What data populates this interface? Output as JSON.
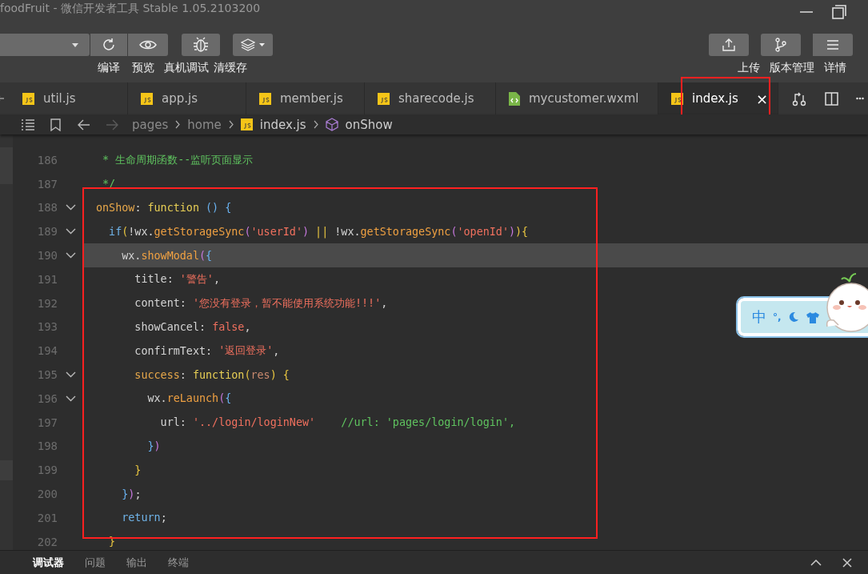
{
  "window": {
    "title": "foodFruit - 微信开发者工具 Stable 1.05.2103200"
  },
  "toolbar": {
    "left_labels": [
      "编译",
      "预览",
      "真机调试",
      "清缓存"
    ],
    "right_labels": [
      "上传",
      "版本管理",
      "详情"
    ]
  },
  "tabs": [
    {
      "label": "util.js",
      "kind": "js",
      "selected": false
    },
    {
      "label": "app.js",
      "kind": "js",
      "selected": false
    },
    {
      "label": "member.js",
      "kind": "js",
      "selected": false
    },
    {
      "label": "sharecode.js",
      "kind": "js",
      "selected": false
    },
    {
      "label": "mycustomer.wxml",
      "kind": "wxml",
      "selected": false
    },
    {
      "label": "index.js",
      "kind": "js",
      "selected": true,
      "close": "×"
    }
  ],
  "breadcrumb": [
    "pages",
    "home",
    "index.js",
    "onShow"
  ],
  "code": [
    {
      "number": "186",
      "fold": false,
      "current": false,
      "tokens": [
        {
          "kind": "cmt",
          "text": " * 生命周期函数--监听页面显示"
        }
      ]
    },
    {
      "number": "187",
      "fold": false,
      "current": false,
      "tokens": [
        {
          "kind": "cmt",
          "text": " */"
        }
      ]
    },
    {
      "number": "188",
      "fold": true,
      "current": false,
      "tokens": [
        {
          "kind": "key",
          "text": "onShow"
        },
        {
          "kind": "plain",
          "text": ": "
        },
        {
          "kind": "fn",
          "text": "function"
        },
        {
          "kind": "b3",
          "text": " () {"
        }
      ]
    },
    {
      "number": "189",
      "fold": true,
      "current": false,
      "tokens": [
        {
          "kind": "kw",
          "text": "  if"
        },
        {
          "kind": "b1",
          "text": "("
        },
        {
          "kind": "plain",
          "text": "!wx."
        },
        {
          "kind": "method",
          "text": "getStorageSync"
        },
        {
          "kind": "b2",
          "text": "("
        },
        {
          "kind": "str",
          "text": "'userId'"
        },
        {
          "kind": "b2",
          "text": ")"
        },
        {
          "kind": "b1",
          "text": " || "
        },
        {
          "kind": "plain",
          "text": "!wx."
        },
        {
          "kind": "method",
          "text": "getStorageSync"
        },
        {
          "kind": "b2",
          "text": "("
        },
        {
          "kind": "str",
          "text": "'openId'"
        },
        {
          "kind": "b2",
          "text": ")"
        },
        {
          "kind": "b1",
          "text": "){"
        }
      ]
    },
    {
      "number": "190",
      "fold": true,
      "current": true,
      "tokens": [
        {
          "kind": "plain",
          "text": "    wx."
        },
        {
          "kind": "method",
          "text": "showModal"
        },
        {
          "kind": "b2",
          "text": "("
        },
        {
          "kind": "b3",
          "text": "{"
        }
      ]
    },
    {
      "number": "191",
      "fold": false,
      "current": false,
      "tokens": [
        {
          "kind": "plain",
          "text": "      title: "
        },
        {
          "kind": "str",
          "text": "'警告'"
        },
        {
          "kind": "plain",
          "text": ","
        }
      ]
    },
    {
      "number": "192",
      "fold": false,
      "current": false,
      "tokens": [
        {
          "kind": "plain",
          "text": "      content: "
        },
        {
          "kind": "str",
          "text": "'您没有登录，暂不能使用系统功能!!!'"
        },
        {
          "kind": "plain",
          "text": ","
        }
      ]
    },
    {
      "number": "193",
      "fold": false,
      "current": false,
      "tokens": [
        {
          "kind": "plain",
          "text": "      showCancel: "
        },
        {
          "kind": "str",
          "text": "false"
        },
        {
          "kind": "plain",
          "text": ","
        }
      ]
    },
    {
      "number": "194",
      "fold": false,
      "current": false,
      "tokens": [
        {
          "kind": "plain",
          "text": "      confirmText: "
        },
        {
          "kind": "str",
          "text": "'返回登录'"
        },
        {
          "kind": "plain",
          "text": ","
        }
      ]
    },
    {
      "number": "195",
      "fold": true,
      "current": false,
      "tokens": [
        {
          "kind": "key",
          "text": "      success"
        },
        {
          "kind": "plain",
          "text": ": "
        },
        {
          "kind": "fn",
          "text": "function"
        },
        {
          "kind": "b1",
          "text": "("
        },
        {
          "kind": "param",
          "text": "res"
        },
        {
          "kind": "b1",
          "text": ") {"
        }
      ]
    },
    {
      "number": "196",
      "fold": true,
      "current": false,
      "tokens": [
        {
          "kind": "plain",
          "text": "        wx."
        },
        {
          "kind": "method",
          "text": "reLaunch"
        },
        {
          "kind": "b2",
          "text": "("
        },
        {
          "kind": "b3",
          "text": "{"
        }
      ]
    },
    {
      "number": "197",
      "fold": false,
      "current": false,
      "tokens": [
        {
          "kind": "plain",
          "text": "          url: "
        },
        {
          "kind": "str",
          "text": "'../login/loginNew'"
        },
        {
          "kind": "cmt",
          "text": "    //url: 'pages/login/login',"
        }
      ]
    },
    {
      "number": "198",
      "fold": false,
      "current": false,
      "tokens": [
        {
          "kind": "b3",
          "text": "        }"
        },
        {
          "kind": "b2",
          "text": ")"
        }
      ]
    },
    {
      "number": "199",
      "fold": false,
      "current": false,
      "tokens": [
        {
          "kind": "b1",
          "text": "      }"
        }
      ]
    },
    {
      "number": "200",
      "fold": false,
      "current": false,
      "tokens": [
        {
          "kind": "b3",
          "text": "    }"
        },
        {
          "kind": "b2",
          "text": ")"
        },
        {
          "kind": "plain",
          "text": ";"
        }
      ]
    },
    {
      "number": "201",
      "fold": false,
      "current": false,
      "tokens": [
        {
          "kind": "kw",
          "text": "    return"
        },
        {
          "kind": "plain",
          "text": ";"
        }
      ]
    },
    {
      "number": "202",
      "fold": false,
      "current": false,
      "tokens": [
        {
          "kind": "b1",
          "text": "  }"
        }
      ]
    }
  ],
  "ime": {
    "mode": "中",
    "punctuation": "°,"
  },
  "bottom_tabs": [
    {
      "label": "调试器",
      "selected": true
    },
    {
      "label": "问题",
      "selected": false
    },
    {
      "label": "输出",
      "selected": false
    },
    {
      "label": "终端",
      "selected": false
    }
  ]
}
